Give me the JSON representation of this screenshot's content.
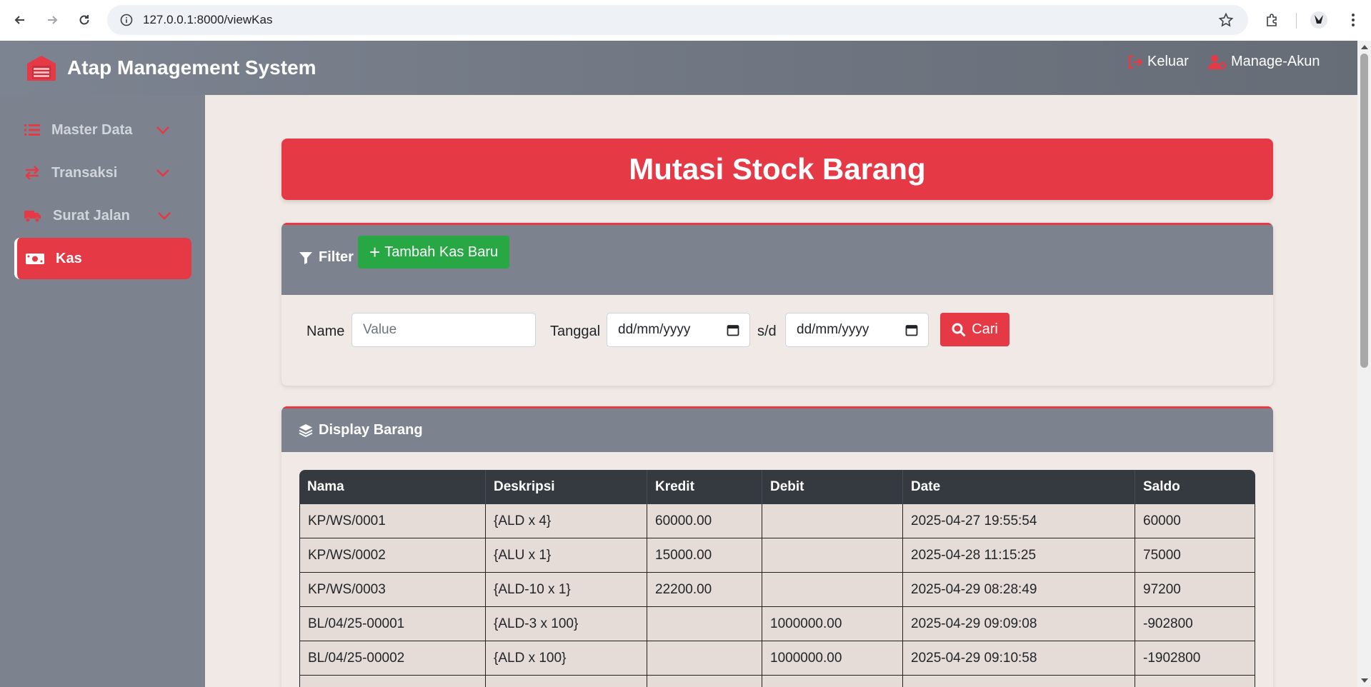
{
  "browser": {
    "url": "127.0.0.1:8000/viewKas"
  },
  "header": {
    "brand_title": "Atap Management System",
    "logout_label": "Keluar",
    "manage_account_label": "Manage-Akun"
  },
  "sidebar": {
    "items": [
      {
        "label": "Master Data",
        "icon": "list-icon",
        "expandable": true
      },
      {
        "label": "Transaksi",
        "icon": "exchange-icon",
        "expandable": true
      },
      {
        "label": "Surat Jalan",
        "icon": "truck-icon",
        "expandable": true
      },
      {
        "label": "Kas",
        "icon": "money-icon",
        "active": true
      }
    ]
  },
  "page": {
    "title": "Mutasi Stock Barang"
  },
  "filter": {
    "heading": "Filter",
    "add_button": "Tambah Kas Baru",
    "name_label": "Name",
    "name_placeholder": "Value",
    "date_label": "Tanggal",
    "date_from": "dd/mm/yyyy",
    "range_sep": "s/d",
    "date_to": "dd/mm/yyyy",
    "search_button": "Cari"
  },
  "display": {
    "heading": "Display Barang",
    "columns": [
      "Nama",
      "Deskripsi",
      "Kredit",
      "Debit",
      "Date",
      "Saldo"
    ],
    "rows": [
      [
        "KP/WS/0001",
        "{ALD x 4}",
        "60000.00",
        "",
        "2025-04-27 19:55:54",
        "60000"
      ],
      [
        "KP/WS/0002",
        "{ALU x 1}",
        "15000.00",
        "",
        "2025-04-28 11:15:25",
        "75000"
      ],
      [
        "KP/WS/0003",
        "{ALD-10 x 1}",
        "22200.00",
        "",
        "2025-04-29 08:28:49",
        "97200"
      ],
      [
        "BL/04/25-00001",
        "{ALD-3 x 100}",
        "",
        "1000000.00",
        "2025-04-29 09:09:08",
        "-902800"
      ],
      [
        "BL/04/25-00002",
        "{ALD x 100}",
        "",
        "1000000.00",
        "2025-04-29 09:10:58",
        "-1902800"
      ],
      [
        "",
        "",
        "",
        "",
        "",
        ""
      ]
    ]
  },
  "colors": {
    "accent_red": "#e63946",
    "success_green": "#28a745",
    "sidebar_gray": "#7c838f",
    "table_header": "#343a40",
    "page_bg": "#f0e9e5"
  }
}
